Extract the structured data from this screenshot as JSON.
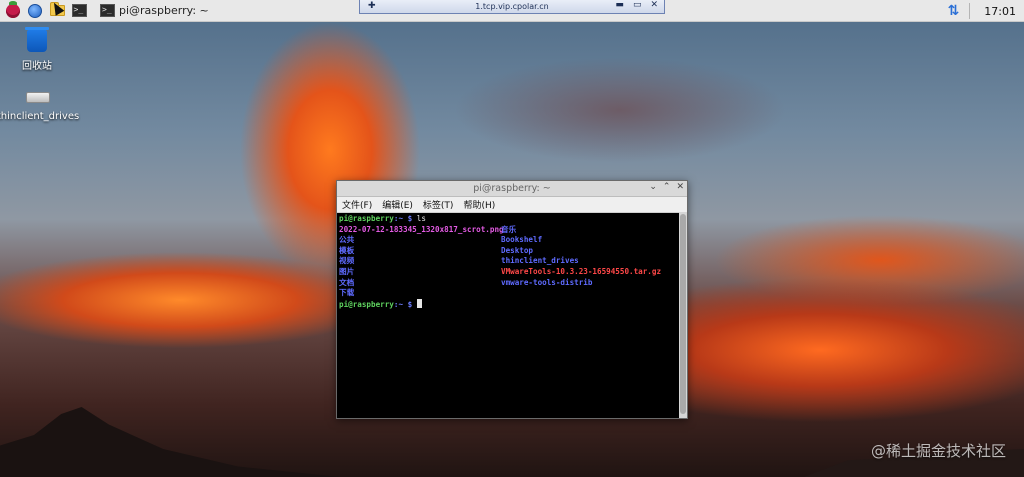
{
  "taskbar": {
    "active_task_label": "pi@raspberry: ~",
    "clock": "17:01",
    "term_glyph": ">_",
    "network_glyph": "⇅"
  },
  "remote_bar": {
    "host": "1.tcp.vip.cpolar.cn",
    "pin_glyph": "✚",
    "ctrl_min": "▬",
    "ctrl_max": "▭",
    "ctrl_close": "✕"
  },
  "desktop": {
    "icons": [
      {
        "label": "回收站"
      },
      {
        "label": "thinclient_drives"
      }
    ]
  },
  "terminal": {
    "title": "pi@raspberry: ~",
    "menus": [
      "文件(F)",
      "编辑(E)",
      "标签(T)",
      "帮助(H)"
    ],
    "prompt_user": "pi@raspberry",
    "prompt_path": ":~ $",
    "command": " ls",
    "ls_col1": [
      {
        "name": "2022-07-12-183345_1320x817_scrot.png",
        "kind": "image"
      },
      {
        "name": "公共",
        "kind": "dir"
      },
      {
        "name": "模板",
        "kind": "dir"
      },
      {
        "name": "视频",
        "kind": "dir"
      },
      {
        "name": "图片",
        "kind": "dir"
      },
      {
        "name": "文档",
        "kind": "dir"
      },
      {
        "name": "下载",
        "kind": "dir"
      }
    ],
    "ls_col2": [
      {
        "name": "音乐",
        "kind": "dir"
      },
      {
        "name": "Bookshelf",
        "kind": "dir"
      },
      {
        "name": "Desktop",
        "kind": "dir"
      },
      {
        "name": "thinclient_drives",
        "kind": "dir"
      },
      {
        "name": "VMwareTools-10.3.23-16594550.tar.gz",
        "kind": "archive"
      },
      {
        "name": "vmware-tools-distrib",
        "kind": "dir"
      }
    ],
    "ctrl_min": "⌄",
    "ctrl_max": "⌃",
    "ctrl_close": "✕"
  },
  "watermark": "@稀土掘金技术社区",
  "colors": {
    "prompt_user": "#5fd25f",
    "dir": "#5f6bff",
    "image": "#e35be3",
    "archive": "#ff4848"
  }
}
